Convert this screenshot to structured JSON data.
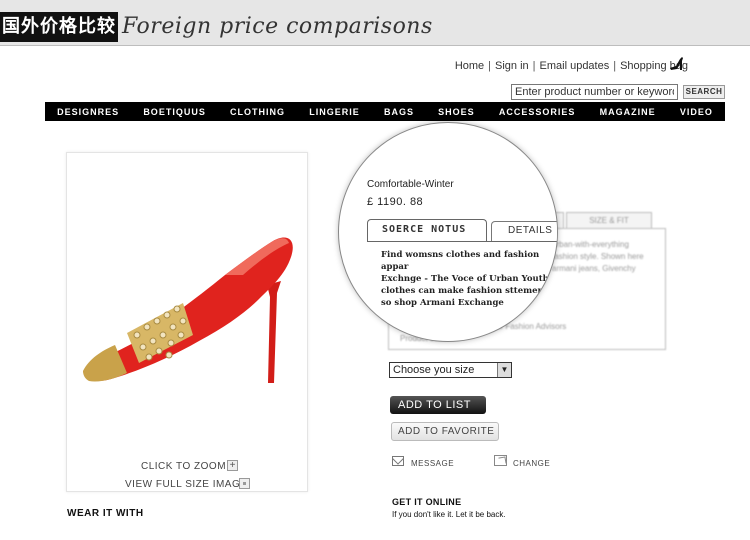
{
  "header": {
    "cn_title": "国外价格比较",
    "script_title": "Foreign price comparisons"
  },
  "utility": {
    "home": "Home",
    "sign_in": "Sign in",
    "email_updates": "Email updates",
    "shopping_bag": "Shopping bag",
    "separator": "|"
  },
  "search": {
    "value": "Enter product number or keyword",
    "button": "SEARCH"
  },
  "nav": [
    "DESIGNRES",
    "BOETIQUUS",
    "CLOTHING",
    "LINGERIE",
    "BAGS",
    "SHOES",
    "ACCESSORIES",
    "MAGAZINE",
    "VIDEO"
  ],
  "product": {
    "name": "Comfortable-Winter",
    "price": "£ 1190. 88",
    "zoom": "CLICK TO ZOOM",
    "full_size": "VIEW FULL SIZE IMAGE",
    "wear_it_with": "WEAR IT WITH",
    "colors": {
      "shoe_red": "#e0231e",
      "gold": "#c9a24a"
    }
  },
  "tabs": {
    "active": "SOERCE NOTUS",
    "details": "DETAILS",
    "size_fit": "SIZE & FIT",
    "description_lines": [
      "Find womsns clothes and fashion appar",
      "Exchnge - The Voce of Urban Youth.",
      " clothes can make fashion sttements",
      "so shop Armani Exchange"
    ],
    "blurred_lines": [
      "urban-with-everything",
      "fashion style. Shown here",
      "armani jeans, Givenchy",
      "ur Fashion Advisors",
      "Product 1128"
    ]
  },
  "actions": {
    "size_select": "Choose you  size",
    "add_to_list": "ADD TO LIST",
    "add_to_favorite": "ADD TO FAVORITE",
    "message": "MESSAGE",
    "change": "CHANGE",
    "get_it_online": "GET IT ONLINE",
    "get_it_online_sub": "If you don't like it. Let it be back."
  }
}
